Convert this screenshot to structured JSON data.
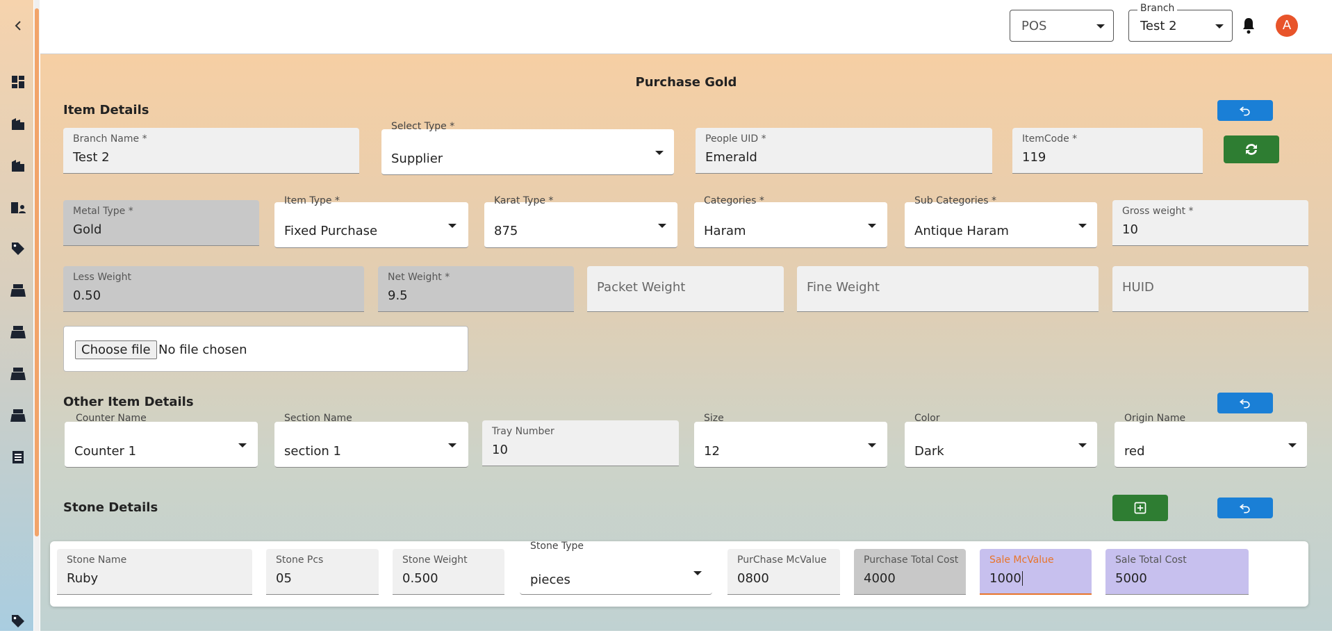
{
  "topbar": {
    "mode_select": {
      "value": "POS"
    },
    "branch_select": {
      "label": "Branch",
      "value": "Test 2"
    },
    "avatar_letter": "A",
    "accent": "#e8542a"
  },
  "sidebar": {
    "collapse_icon": "chevron-left-icon",
    "items": [
      "dashboard-icon",
      "building-icon",
      "building-icon",
      "people-building-icon",
      "tag-icon",
      "register-icon",
      "register-icon",
      "register-icon",
      "register-icon",
      "receipt-icon",
      "tag-icon"
    ]
  },
  "page": {
    "title": "Purchase Gold"
  },
  "item_details": {
    "heading": "Item Details",
    "branch_name": {
      "label": "Branch Name *",
      "value": "Test 2"
    },
    "select_type": {
      "label": "Select Type *",
      "value": "Supplier"
    },
    "people_uid": {
      "label": "People UID *",
      "value": "Emerald"
    },
    "item_code": {
      "label": "ItemCode *",
      "value": "119"
    },
    "metal_type": {
      "label": "Metal Type *",
      "value": "Gold"
    },
    "item_type": {
      "label": "Item Type *",
      "value": "Fixed Purchase"
    },
    "karat_type": {
      "label": "Karat Type *",
      "value": "875"
    },
    "categories": {
      "label": "Categories *",
      "value": "Haram"
    },
    "sub_categories": {
      "label": "Sub Categories *",
      "value": "Antique Haram"
    },
    "gross_weight": {
      "label": "Gross weight *",
      "value": "10"
    },
    "less_weight": {
      "label": "Less Weight",
      "value": "0.50"
    },
    "net_weight": {
      "label": "Net Weight *",
      "value": "9.5"
    },
    "packet_weight": {
      "placeholder": "Packet Weight"
    },
    "fine_weight": {
      "placeholder": "Fine Weight"
    },
    "huid": {
      "placeholder": "HUID"
    },
    "file": {
      "button": "Choose file",
      "status": "No file chosen"
    }
  },
  "other_details": {
    "heading": "Other Item Details",
    "counter_name": {
      "label": "Counter Name",
      "value": "Counter 1"
    },
    "section_name": {
      "label": "Section Name",
      "value": "section 1"
    },
    "tray_number": {
      "label": "Tray Number",
      "value": "10"
    },
    "size": {
      "label": "Size",
      "value": "12"
    },
    "color": {
      "label": "Color",
      "value": "Dark"
    },
    "origin_name": {
      "label": "Origin Name",
      "value": "red"
    }
  },
  "stone_details": {
    "heading": "Stone Details",
    "stone_name": {
      "label": "Stone Name",
      "value": "Ruby"
    },
    "stone_pcs": {
      "label": "Stone Pcs",
      "value": "05"
    },
    "stone_weight": {
      "label": "Stone Weight",
      "value": "0.500"
    },
    "stone_type": {
      "label": "Stone Type",
      "value": "pieces"
    },
    "purchase_mc_value": {
      "label": "PurChase McValue",
      "value": "0800"
    },
    "purchase_total_cost": {
      "label": "Purchase Total Cost",
      "value": "4000"
    },
    "sale_mc_value": {
      "label": "Sale McValue",
      "value": "1000"
    },
    "sale_total_cost": {
      "label": "Sale Total Cost",
      "value": "5000"
    }
  },
  "colors": {
    "blue_button": "#1a7fd6",
    "green_button": "#2e7d32",
    "lavender_field": "#c7c0ee",
    "focus_orange": "#e8742a"
  }
}
